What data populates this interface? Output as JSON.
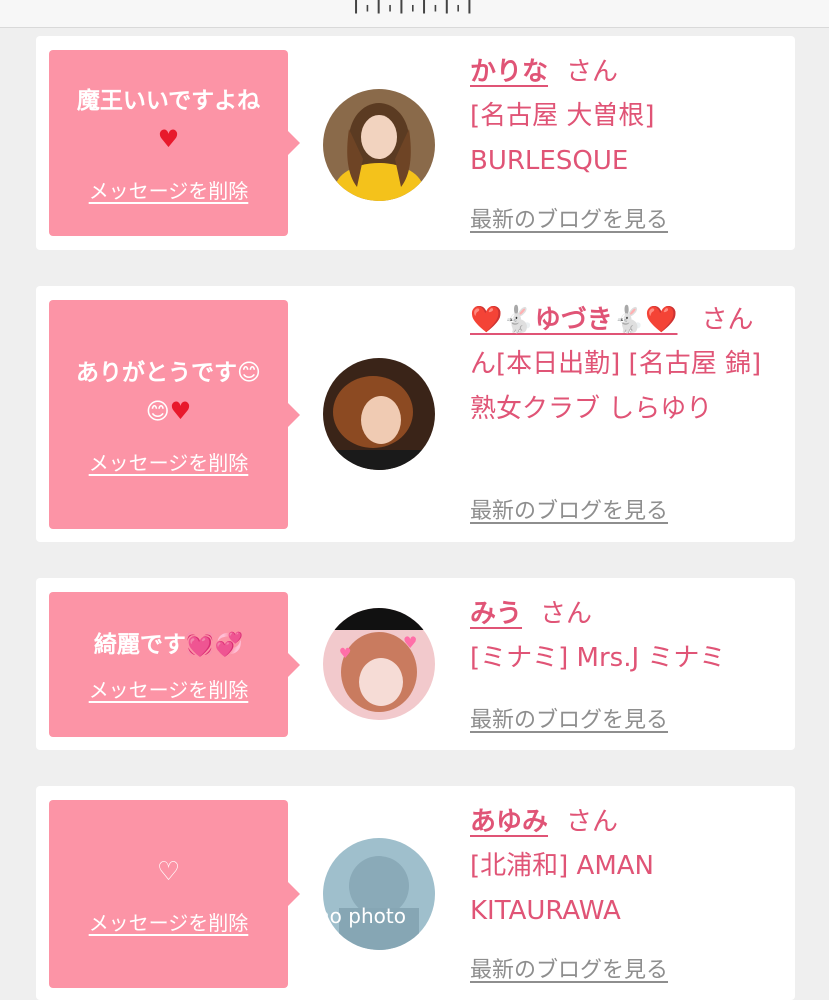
{
  "page": {
    "top_fragment": "|ˌ|ˌ|ˌ|ˌ|ˌ|"
  },
  "labels": {
    "delete": "メッセージを削除",
    "blog": "最新のブログを見る",
    "san": "さん"
  },
  "messages": [
    {
      "text": "魔王いいですよね",
      "icons": [
        "red-heart"
      ],
      "name": "かりな",
      "shop": "[名古屋 大曽根] BURLESQUE"
    },
    {
      "text": "ありがとうです",
      "icons": [
        "smile",
        "smile",
        "red-heart"
      ],
      "name": "❤️🐇ゆづき🐇❤️",
      "shop": "ん[本日出勤] [名古屋 錦] 熟女クラブ しらゆり"
    },
    {
      "text": "綺麗です",
      "icons": [
        "pink-heart",
        "pink-heart"
      ],
      "name": "みう",
      "shop": "[ミナミ] Mrs.J ミナミ"
    },
    {
      "text": "♡",
      "icons": [],
      "name": "あゆみ",
      "shop": "[北浦和] AMAN KITAURAWA",
      "avatar_text": "no photo"
    }
  ],
  "colors": {
    "bubble": "#fc94a6",
    "accent": "#e05476",
    "link": "#8e8e8e"
  }
}
